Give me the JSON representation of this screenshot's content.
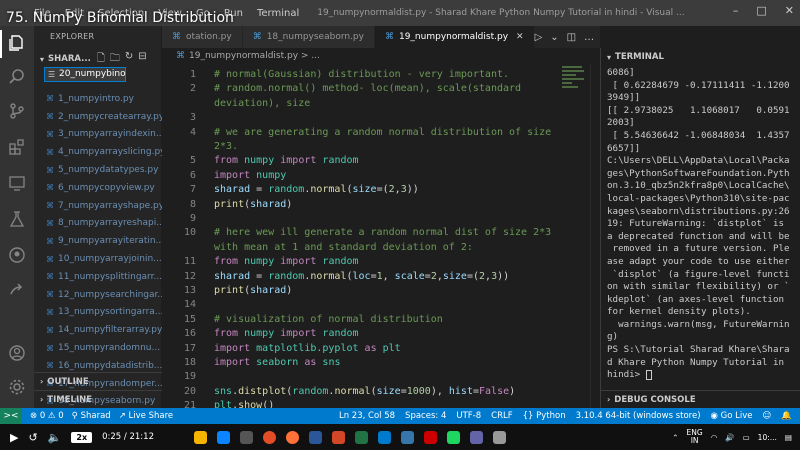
{
  "video": {
    "title": "75. NumPy Binomial Distribution",
    "speed": "2x",
    "time": "0:25 / 21:12",
    "progress": 0.02
  },
  "titlebar": {
    "menu": [
      "File",
      "Edit",
      "Selection",
      "View",
      "Go",
      "Run",
      "Terminal"
    ],
    "window_title": "19_numpynormaldist.py - Sharad Khare Python Numpy Tutorial in hindi - Visual ..."
  },
  "activity": {
    "icons": [
      "files-icon",
      "search-icon",
      "source-control-icon",
      "extensions-icon",
      "remote-explorer-icon",
      "testing-icon",
      "github-icon",
      "live-share-icon",
      "account-icon",
      "settings-gear-icon"
    ]
  },
  "explorer": {
    "title": "EXPLORER",
    "section": "SHARA...",
    "rename_value": "20_numpybino",
    "files": [
      "1_numpyintro.py",
      "2_numpycreatearray.py",
      "3_numpyarrayindexin...",
      "4_numpyarrayslicing.py",
      "5_numpydatatypes.py",
      "6_numpycopyview.py",
      "7_numpyarrayshape.py",
      "8_numpyarrayreshapi...",
      "9_numpyarrayiteratin...",
      "10_numpyarrayjoinin...",
      "11_numpysplittingarr...",
      "12_numpysearchingar...",
      "13_numpysortingarra...",
      "14_numpyfilterarray.py",
      "15_numpyrandomnu...",
      "16_numpydatadistrib...",
      "17_numpyrandomper...",
      "18_numpyseaborn.py"
    ],
    "outline": "OUTLINE",
    "timeline": "TIMELINE"
  },
  "tabs": [
    {
      "label": "otation.py",
      "active": false
    },
    {
      "label": "18_numpyseaborn.py",
      "active": false
    },
    {
      "label": "19_numpynormaldist.py",
      "active": true
    }
  ],
  "breadcrumb": "19_numpynormaldist.py > ...",
  "editor": {
    "current_line": "23",
    "lines": [
      {
        "n": "1",
        "html": "<span class='c-com'># normal(Gaussian) distribution - very important.</span>"
      },
      {
        "n": "2",
        "html": "<span class='c-com'># random.normal() method- loc(mean), scale(standard</span>"
      },
      {
        "n": "",
        "html": "<span class='c-com'>deviation), size</span>"
      },
      {
        "n": "3",
        "html": ""
      },
      {
        "n": "4",
        "html": "<span class='c-com'># we are generating a random normal distribution of size</span>"
      },
      {
        "n": "",
        "html": "<span class='c-com'>2*3.</span>"
      },
      {
        "n": "5",
        "html": "<span class='c-kw'>from</span> <span class='c-mod'>numpy</span> <span class='c-kw'>import</span> <span class='c-mod'>random</span>"
      },
      {
        "n": "6",
        "html": "<span class='c-kw'>import</span> <span class='c-mod'>numpy</span>"
      },
      {
        "n": "7",
        "html": "<span class='c-var'>sharad</span> = <span class='c-mod'>random</span>.<span class='c-fn'>normal</span>(<span class='c-var'>size</span>=(<span class='c-num'>2</span>,<span class='c-num'>3</span>))"
      },
      {
        "n": "8",
        "html": "<span class='c-fn'>print</span>(<span class='c-var'>sharad</span>)"
      },
      {
        "n": "9",
        "html": ""
      },
      {
        "n": "10",
        "html": "<span class='c-com'># here wew ill generate a random normal dist of size 2*3</span>"
      },
      {
        "n": "",
        "html": "<span class='c-com'>with mean at 1 and standard deviation of 2:</span>"
      },
      {
        "n": "11",
        "html": "<span class='c-kw'>from</span> <span class='c-mod'>numpy</span> <span class='c-kw'>import</span> <span class='c-mod'>random</span>"
      },
      {
        "n": "12",
        "html": "<span class='c-var'>sharad</span> = <span class='c-mod'>random</span>.<span class='c-fn'>normal</span>(<span class='c-var'>loc</span>=<span class='c-num'>1</span>, <span class='c-var'>scale</span>=<span class='c-num'>2</span>,<span class='c-var'>size</span>=(<span class='c-num'>2</span>,<span class='c-num'>3</span>))"
      },
      {
        "n": "13",
        "html": "<span class='c-fn'>print</span>(<span class='c-var'>sharad</span>)"
      },
      {
        "n": "14",
        "html": ""
      },
      {
        "n": "15",
        "html": "<span class='c-com'># visualization of normal distribution</span>"
      },
      {
        "n": "16",
        "html": "<span class='c-kw'>from</span> <span class='c-mod'>numpy</span> <span class='c-kw'>import</span> <span class='c-mod'>random</span>"
      },
      {
        "n": "17",
        "html": "<span class='c-kw'>import</span> <span class='c-mod'>matplotlib.pyplot</span> <span class='c-kw'>as</span> <span class='c-mod'>plt</span>"
      },
      {
        "n": "18",
        "html": "<span class='c-kw'>import</span> <span class='c-mod'>seaborn</span> <span class='c-kw'>as</span> <span class='c-mod'>sns</span>"
      },
      {
        "n": "19",
        "html": ""
      },
      {
        "n": "20",
        "html": "<span class='c-mod'>sns</span>.<span class='c-fn'>distplot</span>(<span class='c-mod'>random</span>.<span class='c-fn'>normal</span>(<span class='c-var'>size</span>=<span class='c-num'>1000</span>), <span class='c-var'>hist</span>=<span class='c-kw'>False</span>)"
      },
      {
        "n": "21",
        "html": "<span class='c-mod'>plt</span>.<span class='c-fn'>show</span>()"
      }
    ]
  },
  "terminal": {
    "header": "TERMINAL",
    "lines": [
      "6086]",
      " [ 0.62284679 -0.17111411 -1.1200",
      "3949]]",
      "[[ 2.9738025   1.1068017   0.0591",
      "2003]",
      " [ 5.54636642 -1.06848034  1.4357",
      "6657]]",
      "C:\\Users\\DELL\\AppData\\Local\\Packa",
      "ges\\PythonSoftwareFoundation.Pyth",
      "on.3.10_qbz5n2kfra8p0\\LocalCache\\",
      "local-packages\\Python310\\site-pac",
      "kages\\seaborn\\distributions.py:26",
      "19: FutureWarning: `distplot` is",
      "a deprecated function and will be",
      " removed in a future version. Ple",
      "ase adapt your code to use either",
      " `displot` (a figure-level functi",
      "on with similar flexibility) or `",
      "kdeplot` (an axes-level function",
      "for kernel density plots).",
      "  warnings.warn(msg, FutureWarnin",
      "g)",
      "PS S:\\Tutorial Sharad Khare\\Shara",
      "d Khare Python Numpy Tutorial in",
      "hindi> "
    ],
    "footer": "DEBUG CONSOLE"
  },
  "statusbar": {
    "remote": "><",
    "problems": "⊗ 0 ⚠ 0",
    "user": "Sharad",
    "live_share": "Live Share",
    "position": "Ln 23, Col 58",
    "spaces": "Spaces: 4",
    "encoding": "UTF-8",
    "eol": "CRLF",
    "language": "Python",
    "interpreter": "3.10.4 64-bit (windows store)",
    "go_live": "Go Live"
  },
  "tray": {
    "lang_top": "ENG",
    "lang_bottom": "IN",
    "time": "10:..."
  },
  "colors": {
    "accent": "#007acc",
    "player_progress": "#ff0000"
  }
}
